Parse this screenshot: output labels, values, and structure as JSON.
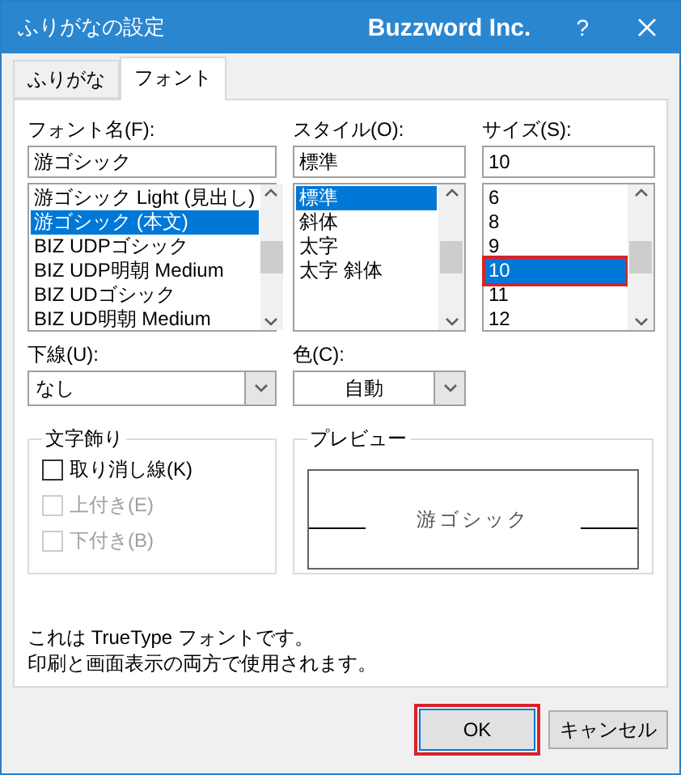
{
  "window": {
    "title": "ふりがなの設定",
    "brand": "Buzzword Inc.",
    "help": "?"
  },
  "tabs": [
    {
      "label": "ふりがな",
      "selected": false
    },
    {
      "label": "フォント",
      "selected": true
    }
  ],
  "font_name": {
    "label": "フォント名(F):",
    "value": "游ゴシック",
    "items": [
      {
        "label": "游ゴシック Light (見出し)",
        "selected": false
      },
      {
        "label": "游ゴシック (本文)",
        "selected": true
      },
      {
        "label": "BIZ UDPゴシック",
        "selected": false
      },
      {
        "label": "BIZ UDP明朝 Medium",
        "selected": false
      },
      {
        "label": "BIZ UDゴシック",
        "selected": false
      },
      {
        "label": "BIZ UD明朝 Medium",
        "selected": false
      }
    ]
  },
  "style": {
    "label": "スタイル(O):",
    "value": "標準",
    "items": [
      {
        "label": "標準",
        "selected": true
      },
      {
        "label": "斜体",
        "selected": false
      },
      {
        "label": "太字",
        "selected": false
      },
      {
        "label": "太字 斜体",
        "selected": false
      }
    ]
  },
  "size": {
    "label": "サイズ(S):",
    "value": "10",
    "items": [
      {
        "label": "6",
        "selected": false,
        "highlighted": false
      },
      {
        "label": "8",
        "selected": false,
        "highlighted": false
      },
      {
        "label": "9",
        "selected": false,
        "highlighted": false
      },
      {
        "label": "10",
        "selected": true,
        "highlighted": true
      },
      {
        "label": "11",
        "selected": false,
        "highlighted": false
      },
      {
        "label": "12",
        "selected": false,
        "highlighted": false
      }
    ]
  },
  "underline": {
    "label": "下線(U):",
    "value": "なし"
  },
  "color": {
    "label": "色(C):",
    "value": "自動"
  },
  "effects": {
    "title": "文字飾り",
    "items": [
      {
        "label": "取り消し線(K)",
        "checked": false,
        "disabled": false
      },
      {
        "label": "上付き(E)",
        "checked": false,
        "disabled": true
      },
      {
        "label": "下付き(B)",
        "checked": false,
        "disabled": true
      }
    ]
  },
  "preview": {
    "title": "プレビュー",
    "sample": "游ゴシック"
  },
  "description": [
    "これは TrueType フォントです。",
    "印刷と画面表示の両方で使用されます。"
  ],
  "buttons": [
    {
      "label": "OK",
      "highlighted": true
    },
    {
      "label": "キャンセル",
      "highlighted": false
    }
  ]
}
